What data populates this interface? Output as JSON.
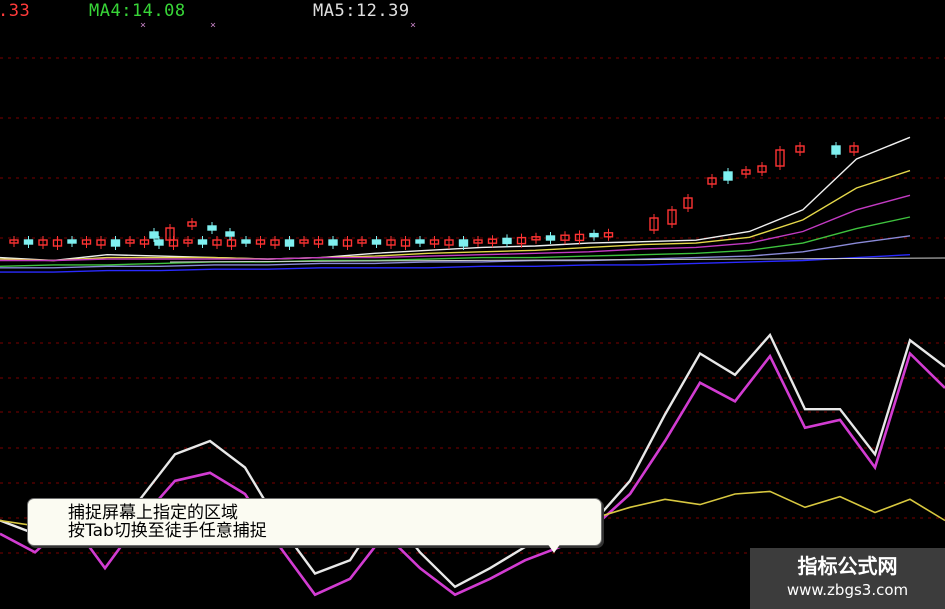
{
  "header": {
    "ma3_partial": ".33",
    "ma4_label": "MA4:14.08",
    "ma5_label": "MA5:12.39"
  },
  "tooltip": {
    "line1": "捕捉屏幕上指定的区域",
    "line2": "按Tab切换至徒手任意捕捉"
  },
  "watermark": {
    "title": "指标公式网",
    "url": "www.zbgs3.com"
  },
  "colors": {
    "background": "#000000",
    "ma3": "#ff3b3b",
    "ma4": "#38d638",
    "ma5": "#e0e0e0",
    "candle_up": "#ff3333",
    "candle_down": "#7ff0f0",
    "grid": "#7a0000",
    "osc_white": "#e8e8e8",
    "osc_magenta": "#d23cd2",
    "osc_yellow": "#d8c840"
  },
  "chart_data": {
    "type": "line",
    "panels": [
      "price",
      "oscillator"
    ],
    "series": [
      {
        "values": [
          0.12,
          0.1,
          0.14,
          0.13,
          0.12,
          0.11,
          0.12,
          0.15,
          0.17,
          0.19,
          0.2,
          0.22,
          0.23,
          0.24,
          0.3,
          0.45,
          0.8,
          0.95
        ]
      },
      {
        "values": [
          0.11,
          0.1,
          0.12,
          0.12,
          0.12,
          0.11,
          0.12,
          0.13,
          0.15,
          0.16,
          0.17,
          0.19,
          0.21,
          0.22,
          0.26,
          0.38,
          0.6,
          0.72
        ]
      },
      {
        "values": [
          0.1,
          0.1,
          0.11,
          0.11,
          0.11,
          0.11,
          0.12,
          0.12,
          0.13,
          0.14,
          0.15,
          0.16,
          0.18,
          0.19,
          0.22,
          0.3,
          0.45,
          0.55
        ]
      },
      {
        "values": [
          0.06,
          0.07,
          0.07,
          0.08,
          0.09,
          0.09,
          0.1,
          0.1,
          0.11,
          0.12,
          0.12,
          0.13,
          0.14,
          0.15,
          0.17,
          0.22,
          0.32,
          0.4
        ]
      },
      {
        "values": [
          0.05,
          0.05,
          0.06,
          0.06,
          0.07,
          0.07,
          0.08,
          0.08,
          0.09,
          0.09,
          0.1,
          0.1,
          0.11,
          0.12,
          0.13,
          0.16,
          0.22,
          0.27
        ]
      },
      {
        "values": [
          0.02,
          0.02,
          0.03,
          0.03,
          0.04,
          0.04,
          0.05,
          0.05,
          0.05,
          0.06,
          0.06,
          0.07,
          0.07,
          0.08,
          0.09,
          0.1,
          0.12,
          0.14
        ]
      }
    ],
    "oscillator_series": [
      {
        "values": [
          0.3,
          0.25,
          0.33,
          0.22,
          0.38,
          0.55,
          0.6,
          0.5,
          0.28,
          0.1,
          0.15,
          0.35,
          0.18,
          0.05,
          0.12,
          0.2,
          0.25,
          0.3,
          0.45,
          0.7,
          0.93,
          0.85,
          1.0,
          0.72,
          0.72,
          0.55,
          0.98,
          0.88
        ]
      },
      {
        "values": [
          0.25,
          0.18,
          0.3,
          0.12,
          0.3,
          0.45,
          0.48,
          0.4,
          0.2,
          0.02,
          0.08,
          0.25,
          0.12,
          0.02,
          0.08,
          0.15,
          0.2,
          0.28,
          0.4,
          0.6,
          0.82,
          0.75,
          0.92,
          0.65,
          0.68,
          0.5,
          0.93,
          0.8
        ]
      },
      {
        "values": [
          0.3,
          0.28,
          0.28,
          0.3,
          0.27,
          0.26,
          0.28,
          0.29,
          0.27,
          0.25,
          0.28,
          0.3,
          0.27,
          0.28,
          0.29,
          0.27,
          0.3,
          0.31,
          0.35,
          0.38,
          0.36,
          0.4,
          0.41,
          0.35,
          0.39,
          0.33,
          0.38,
          0.3
        ]
      }
    ]
  }
}
